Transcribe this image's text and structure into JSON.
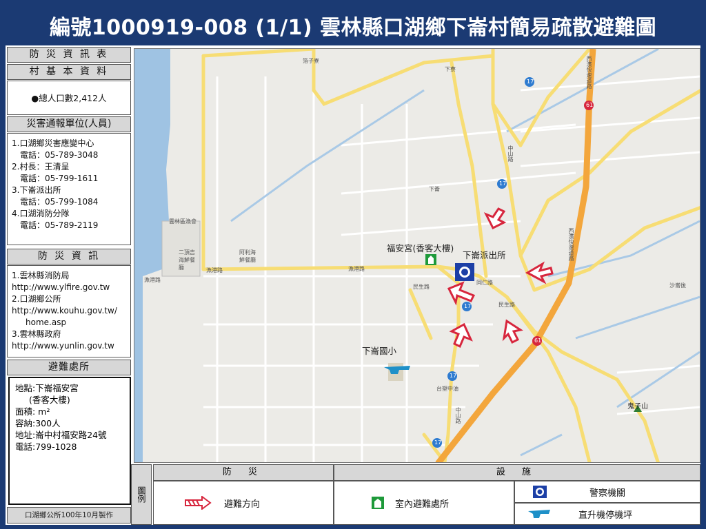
{
  "title": "編號1000919-008 (1/1)  雲林縣口湖鄉下崙村簡易疏散避難圖",
  "sidebar": {
    "disaster_table_head": "防 災 資 訊 表",
    "village_head": "村 基 本 資 料",
    "population": "●總人口數2,412人",
    "report_head": "災害通報單位(人員)",
    "report_lines": [
      "1.口湖鄉災害應變中心",
      "電話：05-789-3048",
      "2.村長：王清呈",
      "電話：05-799-1611",
      "3.下崙派出所",
      "電話：05-799-1084",
      "4.口湖消防分隊",
      "電話：05-789-2119"
    ],
    "info_head": "防 災 資 訊",
    "info_lines": [
      "1.雲林縣消防局",
      "http://www.ylfire.gov.tw",
      "2.口湖鄉公所",
      "http://www.kouhu.gov.tw/",
      "home.asp",
      "3.雲林縣政府",
      "http://www.yunlin.gov.tw"
    ],
    "shelter_head": "避難處所",
    "shelter_lines": [
      "地點:下崙福安宮",
      "(香客大樓)",
      "面積:      m²",
      "容納:300人",
      "地址:崙中村福安路24號",
      "電話:799-1028"
    ],
    "footer": "口湖鄉公所100年10月製作"
  },
  "map": {
    "labels": {
      "temple": "福安宮(香客大樓)",
      "police": "下崙派出所",
      "school": "下崙國小"
    },
    "place_labels": {
      "kengzi": "箔子寮",
      "xialun_n": "下寮",
      "xialun": "下崙",
      "fish_assoc": "雲林區漁會",
      "seafood1": "二頂吉海鮮餐廳",
      "seafood2": "阿利海鮮餐廳",
      "yugang1": "漁港路",
      "yugang2": "漁港路",
      "yugang3": "漁港路",
      "minsheng1": "民生路",
      "minsheng2": "民生路",
      "tongren": "同仁路",
      "zhongshan1": "中山路",
      "zhongshan2": "中山路",
      "guizishan": "鬼子山",
      "shalun": "沙崙後",
      "taisu": "台塑中油",
      "xibin1": "西濱快速道路",
      "xibin2": "西濱快速道路",
      "route17a": "17",
      "route17b": "17",
      "route17c": "17",
      "route17d": "17",
      "route17e": "17",
      "route61a": "61",
      "route61b": "61"
    }
  },
  "legend": {
    "side": "圖例",
    "head_disaster": "防  災",
    "head_facility": "設  施",
    "evac": "避難方向",
    "indoor": "室內避難處所",
    "police": "警察機關",
    "helipad": "直升機停機坪"
  },
  "colors": {
    "title_bg": "#1b3a73",
    "header_bg": "#d7d7d7",
    "road_yellow": "#f7dd74",
    "expressway": "#f3a63c",
    "sea": "#9fc3e3",
    "arrow_red": "#d7263d"
  }
}
